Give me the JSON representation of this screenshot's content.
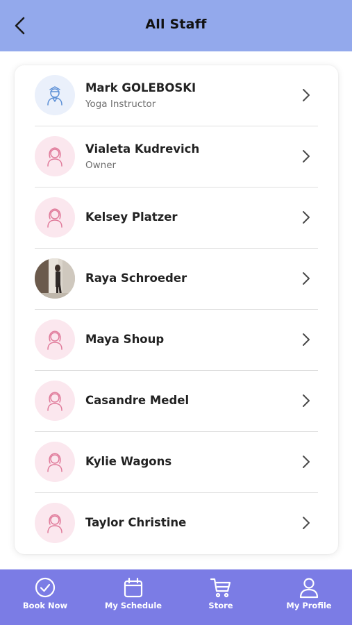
{
  "header": {
    "title": "All Staff",
    "back_icon": "chevron-left-icon",
    "background": "#93a9ec"
  },
  "staff": [
    {
      "name": "Mark GOLEBOSKI",
      "role": "Yoga Instructor",
      "avatar": "male-avatar-icon"
    },
    {
      "name": "Vialeta Kudrevich",
      "role": "Owner",
      "avatar": "female-avatar-icon"
    },
    {
      "name": "Kelsey Platzer",
      "role": "",
      "avatar": "female-avatar-icon"
    },
    {
      "name": "Raya Schroeder",
      "role": "",
      "avatar": "profile-photo"
    },
    {
      "name": "Maya Shoup",
      "role": "",
      "avatar": "female-avatar-icon"
    },
    {
      "name": "Casandre Medel",
      "role": "",
      "avatar": "female-avatar-icon"
    },
    {
      "name": "Kylie Wagons",
      "role": "",
      "avatar": "female-avatar-icon"
    },
    {
      "name": "Taylor Christine",
      "role": "",
      "avatar": "female-avatar-icon"
    }
  ],
  "bottom_nav": {
    "background": "#7b7ce5",
    "items": [
      {
        "label": "Book Now",
        "icon": "check-circle-icon"
      },
      {
        "label": "My Schedule",
        "icon": "calendar-icon"
      },
      {
        "label": "Store",
        "icon": "cart-icon"
      },
      {
        "label": "My Profile",
        "icon": "user-icon"
      }
    ]
  }
}
